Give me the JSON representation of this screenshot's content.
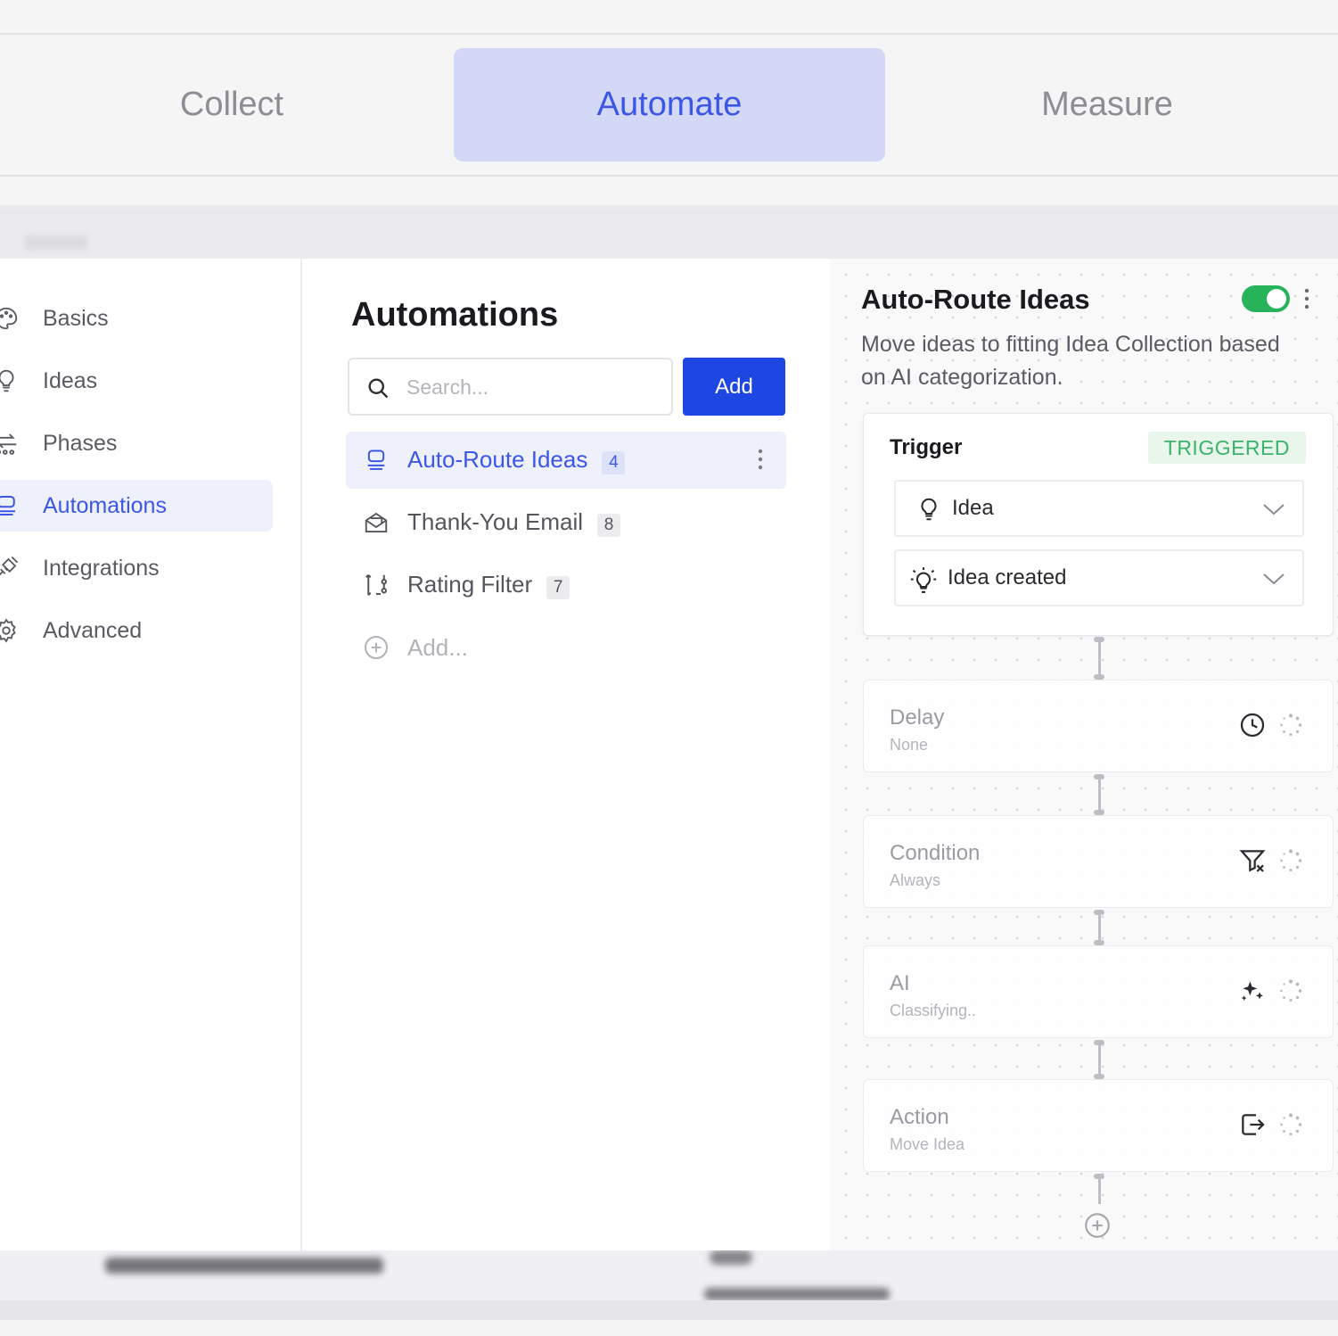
{
  "tabs": [
    {
      "label": "Collect",
      "active": false
    },
    {
      "label": "Automate",
      "active": true
    },
    {
      "label": "Measure",
      "active": false
    }
  ],
  "sidebar": {
    "items": [
      {
        "label": "Basics",
        "icon": "palette-icon",
        "active": false
      },
      {
        "label": "Ideas",
        "icon": "lightbulb-icon",
        "active": false
      },
      {
        "label": "Phases",
        "icon": "phases-icon",
        "active": false
      },
      {
        "label": "Automations",
        "icon": "robot-icon",
        "active": true
      },
      {
        "label": "Integrations",
        "icon": "plug-icon",
        "active": false
      },
      {
        "label": "Advanced",
        "icon": "gear-icon",
        "active": false
      }
    ]
  },
  "automations": {
    "title": "Automations",
    "search_placeholder": "Search...",
    "add_label": "Add",
    "items": [
      {
        "label": "Auto-Route Ideas",
        "count": "4",
        "icon": "robot-icon",
        "active": true
      },
      {
        "label": "Thank-You Email",
        "count": "8",
        "icon": "mail-icon",
        "active": false
      },
      {
        "label": "Rating Filter",
        "count": "7",
        "icon": "branch-icon",
        "active": false
      }
    ],
    "add_item_label": "Add..."
  },
  "detail": {
    "title": "Auto-Route Ideas",
    "enabled": true,
    "description": "Move ideas to fitting Idea Collection based on AI categorization.",
    "trigger": {
      "heading": "Trigger",
      "status": "TRIGGERED",
      "object_select": "Idea",
      "event_select": "Idea created"
    },
    "steps": [
      {
        "name": "Delay",
        "sub": "None",
        "icon": "clock-icon"
      },
      {
        "name": "Condition",
        "sub": "Always",
        "icon": "filter-x-icon"
      },
      {
        "name": "AI",
        "sub": "Classifying..",
        "icon": "sparkles-icon"
      },
      {
        "name": "Action",
        "sub": "Move Idea",
        "icon": "move-to-icon"
      }
    ]
  },
  "colors": {
    "accent": "#3c57e6",
    "primary_button": "#1e46e3",
    "active_tab_bg": "#d2d8f6",
    "toggle_on": "#27b35a",
    "triggered_badge": "#3cb26a"
  }
}
